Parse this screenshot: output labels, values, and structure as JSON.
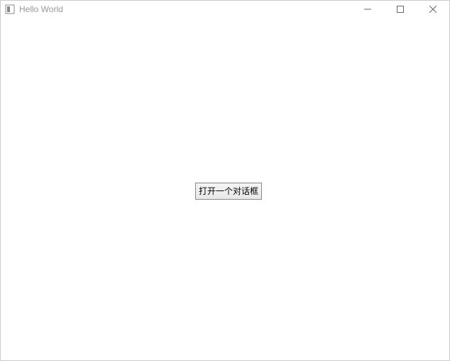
{
  "window": {
    "title": "Hello World"
  },
  "content": {
    "open_dialog_button_label": "打开一个对话框"
  }
}
